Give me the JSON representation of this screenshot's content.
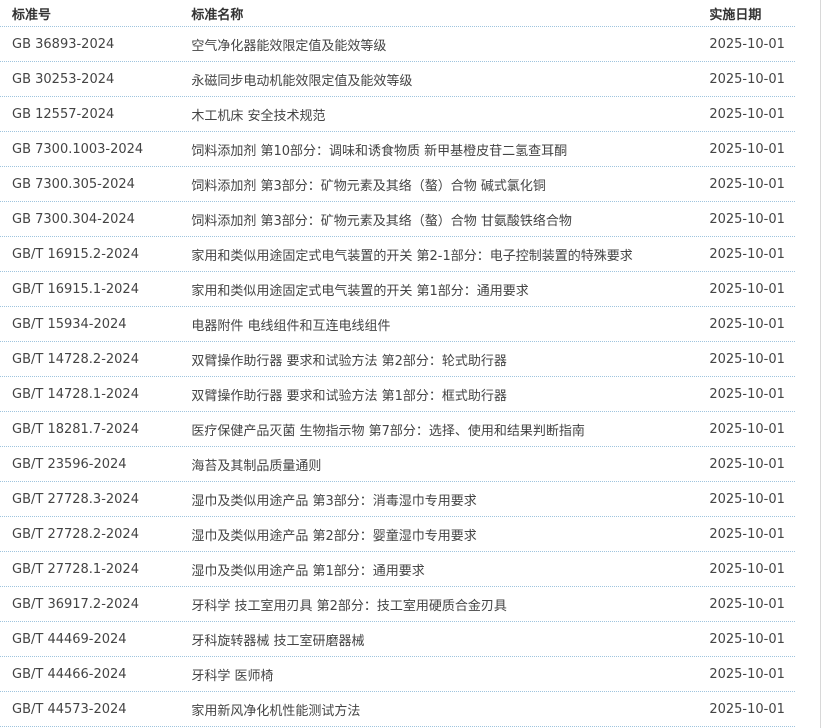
{
  "table": {
    "headers": {
      "code": "标准号",
      "name": "标准名称",
      "date": "实施日期"
    },
    "rows": [
      {
        "code": "GB 36893-2024",
        "name": "空气净化器能效限定值及能效等级",
        "date": "2025-10-01"
      },
      {
        "code": "GB 30253-2024",
        "name": "永磁同步电动机能效限定值及能效等级",
        "date": "2025-10-01"
      },
      {
        "code": "GB 12557-2024",
        "name": "木工机床 安全技术规范",
        "date": "2025-10-01"
      },
      {
        "code": "GB 7300.1003-2024",
        "name": "饲料添加剂 第10部分：调味和诱食物质 新甲基橙皮苷二氢查耳酮",
        "date": "2025-10-01"
      },
      {
        "code": "GB 7300.305-2024",
        "name": "饲料添加剂 第3部分：矿物元素及其络（螯）合物 碱式氯化铜",
        "date": "2025-10-01"
      },
      {
        "code": "GB 7300.304-2024",
        "name": "饲料添加剂 第3部分：矿物元素及其络（螯）合物 甘氨酸铁络合物",
        "date": "2025-10-01"
      },
      {
        "code": "GB/T 16915.2-2024",
        "name": "家用和类似用途固定式电气装置的开关 第2-1部分：电子控制装置的特殊要求",
        "date": "2025-10-01"
      },
      {
        "code": "GB/T 16915.1-2024",
        "name": "家用和类似用途固定式电气装置的开关 第1部分：通用要求",
        "date": "2025-10-01"
      },
      {
        "code": "GB/T 15934-2024",
        "name": "电器附件 电线组件和互连电线组件",
        "date": "2025-10-01"
      },
      {
        "code": "GB/T 14728.2-2024",
        "name": "双臂操作助行器 要求和试验方法 第2部分：轮式助行器",
        "date": "2025-10-01"
      },
      {
        "code": "GB/T 14728.1-2024",
        "name": "双臂操作助行器 要求和试验方法 第1部分：框式助行器",
        "date": "2025-10-01"
      },
      {
        "code": "GB/T 18281.7-2024",
        "name": "医疗保健产品灭菌 生物指示物 第7部分：选择、使用和结果判断指南",
        "date": "2025-10-01"
      },
      {
        "code": "GB/T 23596-2024",
        "name": "海苔及其制品质量通则",
        "date": "2025-10-01"
      },
      {
        "code": "GB/T 27728.3-2024",
        "name": "湿巾及类似用途产品 第3部分：消毒湿巾专用要求",
        "date": "2025-10-01"
      },
      {
        "code": "GB/T 27728.2-2024",
        "name": "湿巾及类似用途产品 第2部分：婴童湿巾专用要求",
        "date": "2025-10-01"
      },
      {
        "code": "GB/T 27728.1-2024",
        "name": "湿巾及类似用途产品 第1部分：通用要求",
        "date": "2025-10-01"
      },
      {
        "code": "GB/T 36917.2-2024",
        "name": "牙科学 技工室用刃具 第2部分：技工室用硬质合金刃具",
        "date": "2025-10-01"
      },
      {
        "code": "GB/T 44469-2024",
        "name": "牙科旋转器械 技工室研磨器械",
        "date": "2025-10-01"
      },
      {
        "code": "GB/T 44466-2024",
        "name": "牙科学 医师椅",
        "date": "2025-10-01"
      },
      {
        "code": "GB/T 44573-2024",
        "name": "家用新风净化机性能测试方法",
        "date": "2025-10-01"
      }
    ]
  }
}
